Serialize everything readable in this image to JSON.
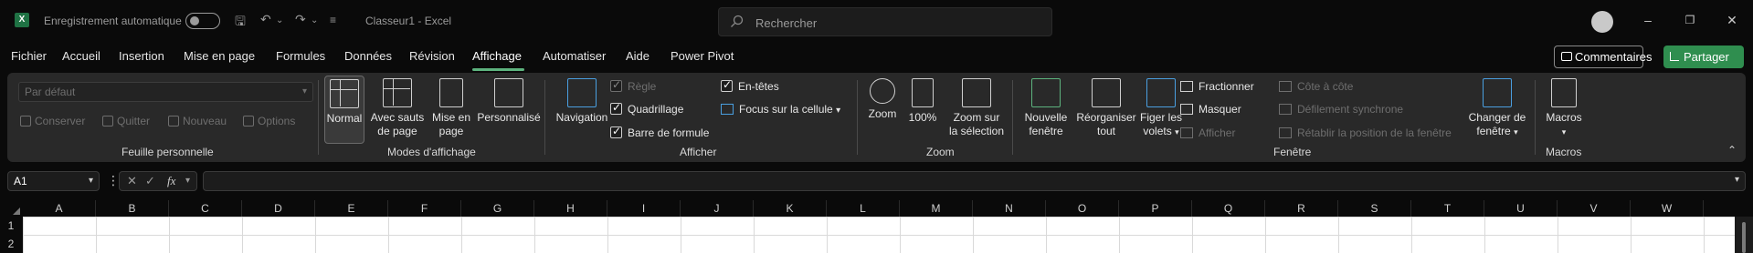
{
  "titlebar": {
    "autosave_label": "Enregistrement automatique",
    "doc_title": "Classeur1  -  Excel",
    "search_placeholder": "Rechercher"
  },
  "tabs": [
    "Fichier",
    "Accueil",
    "Insertion",
    "Mise en page",
    "Formules",
    "Données",
    "Révision",
    "Affichage",
    "Automatiser",
    "Aide",
    "Power Pivot"
  ],
  "active_tab": "Affichage",
  "actions": {
    "comments": "Commentaires",
    "share": "Partager"
  },
  "ribbon": {
    "feuille": {
      "select_value": "Par défaut",
      "buttons": [
        "Conserver",
        "Quitter",
        "Nouveau",
        "Options"
      ],
      "label": "Feuille personnelle"
    },
    "modes": {
      "buttons": [
        {
          "line1": "Normal",
          "line2": ""
        },
        {
          "line1": "Avec sauts",
          "line2": "de page"
        },
        {
          "line1": "Mise en",
          "line2": "page"
        },
        {
          "line1": "Personnalisé",
          "line2": ""
        }
      ],
      "label": "Modes d'affichage"
    },
    "afficher": {
      "navigation": "Navigation",
      "regle": "Règle",
      "quadrillage": "Quadrillage",
      "barre": "Barre de formule",
      "entetes": "En-têtes",
      "focus": "Focus sur la cellule",
      "label": "Afficher"
    },
    "zoom": {
      "zoom": "Zoom",
      "pct": "100%",
      "sel_line1": "Zoom sur",
      "sel_line2": "la sélection",
      "label": "Zoom"
    },
    "fenetre": {
      "nouvelle_1": "Nouvelle",
      "nouvelle_2": "fenêtre",
      "reorg_1": "Réorganiser",
      "reorg_2": "tout",
      "figer_1": "Figer les",
      "figer_2": "volets",
      "fractionner": "Fractionner",
      "masquer": "Masquer",
      "afficher": "Afficher",
      "cote": "Côte à côte",
      "defilement": "Défilement synchrone",
      "retablir": "Rétablir la position de la fenêtre",
      "changer_1": "Changer de",
      "changer_2": "fenêtre",
      "label": "Fenêtre"
    },
    "macros": {
      "btn": "Macros",
      "label": "Macros"
    }
  },
  "formula": {
    "namebox": "A1",
    "fx": "fx"
  },
  "columns": [
    "A",
    "B",
    "C",
    "D",
    "E",
    "F",
    "G",
    "H",
    "I",
    "J",
    "K",
    "L",
    "M",
    "N",
    "O",
    "P",
    "Q",
    "R",
    "S",
    "T",
    "U",
    "V",
    "W"
  ],
  "rows": [
    "1",
    "2"
  ]
}
